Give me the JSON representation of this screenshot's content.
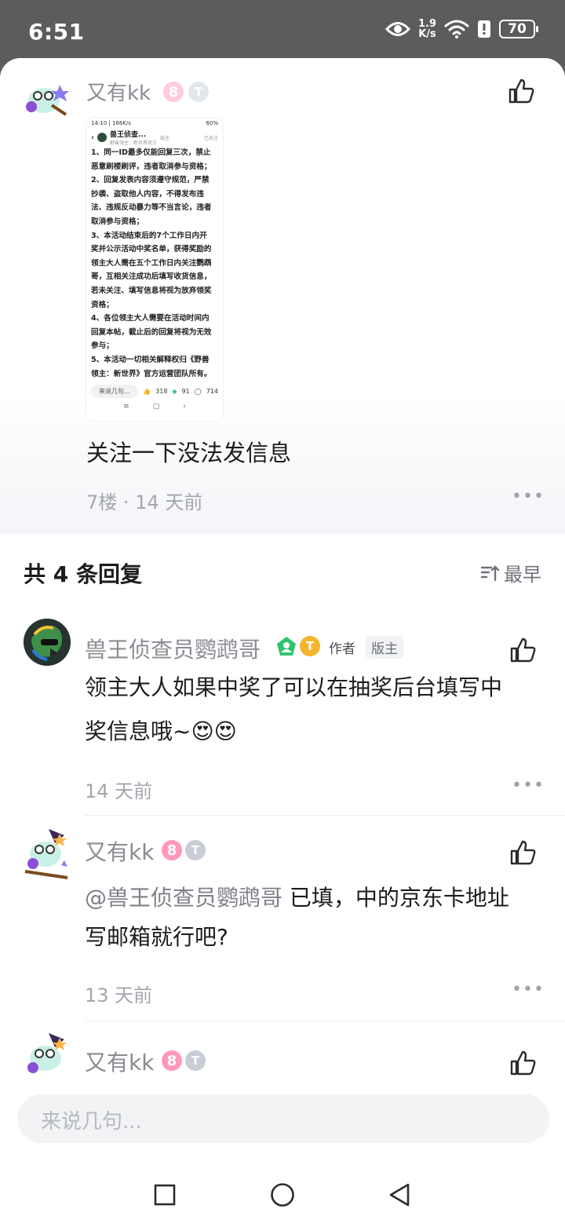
{
  "status_bar": {
    "time": "6:51",
    "speed_value": "1.9",
    "speed_unit": "K/s",
    "battery": "70"
  },
  "post": {
    "author_name": "又有kk",
    "screenshot": {
      "status_left": "14:10 | 166K/s",
      "status_right": "60%",
      "title": "兽王侦查...",
      "subtitle": "野兽领主：新世界官方",
      "badge": "版主",
      "follow": "已关注",
      "body": "1、同一ID最多仅能回复三次，禁止\n恶意刷楼刷评，违者取消参与资格；\n2、回复发表内容须遵守规范，严禁\n抄袭、盗取他人内容，不得发布违\n法、违规反动暴力等不当言论，违者\n取消参与资格；\n3、本活动结束后的7个工作日内开\n奖并公示活动中奖名单，获得奖励的\n领主大人需在五个工作日内关注鹦鹉\n哥，互相关注成功后填写收货信息，\n若未关注、填写信息将视为放弃领奖\n资格；\n4、各位领主大人需要在活动时间内\n回复本帖，截止后的回复将视为无效\n参与；\n5、本活动一切相关解释权归《野兽\n领主：新世界》官方运营团队所有。",
      "input_placeholder": "来说几句...",
      "likes": "318",
      "gems": "91",
      "comments": "714"
    },
    "text": "关注一下没法发信息",
    "meta": "7楼 · 14 天前"
  },
  "replies_header": {
    "title": "共 4 条回复",
    "sort_label": "最早"
  },
  "replies": [
    {
      "name": "兽王侦查员鹦鹉哥",
      "tag_author": "作者",
      "tag_mod": "版主",
      "text_line1": "领主大人如果中奖了可以在抽奖后台填写中",
      "text_line2": "奖信息哦~",
      "emoji": "😍😍",
      "meta": "14 天前"
    },
    {
      "name": "又有kk",
      "level": "8",
      "mention": "@兽王侦查员鹦鹉哥",
      "text_line1": "已填，中的京东卡地址",
      "text_line2": "写邮箱就行吧?",
      "meta": "13 天前"
    },
    {
      "name": "又有kk",
      "level": "8"
    }
  ],
  "composer": {
    "placeholder": "来说几句..."
  },
  "colors": {
    "accent_green": "#2fc36c",
    "level_pink": "#ff98bb",
    "coin_gold": "#f4b52e"
  }
}
